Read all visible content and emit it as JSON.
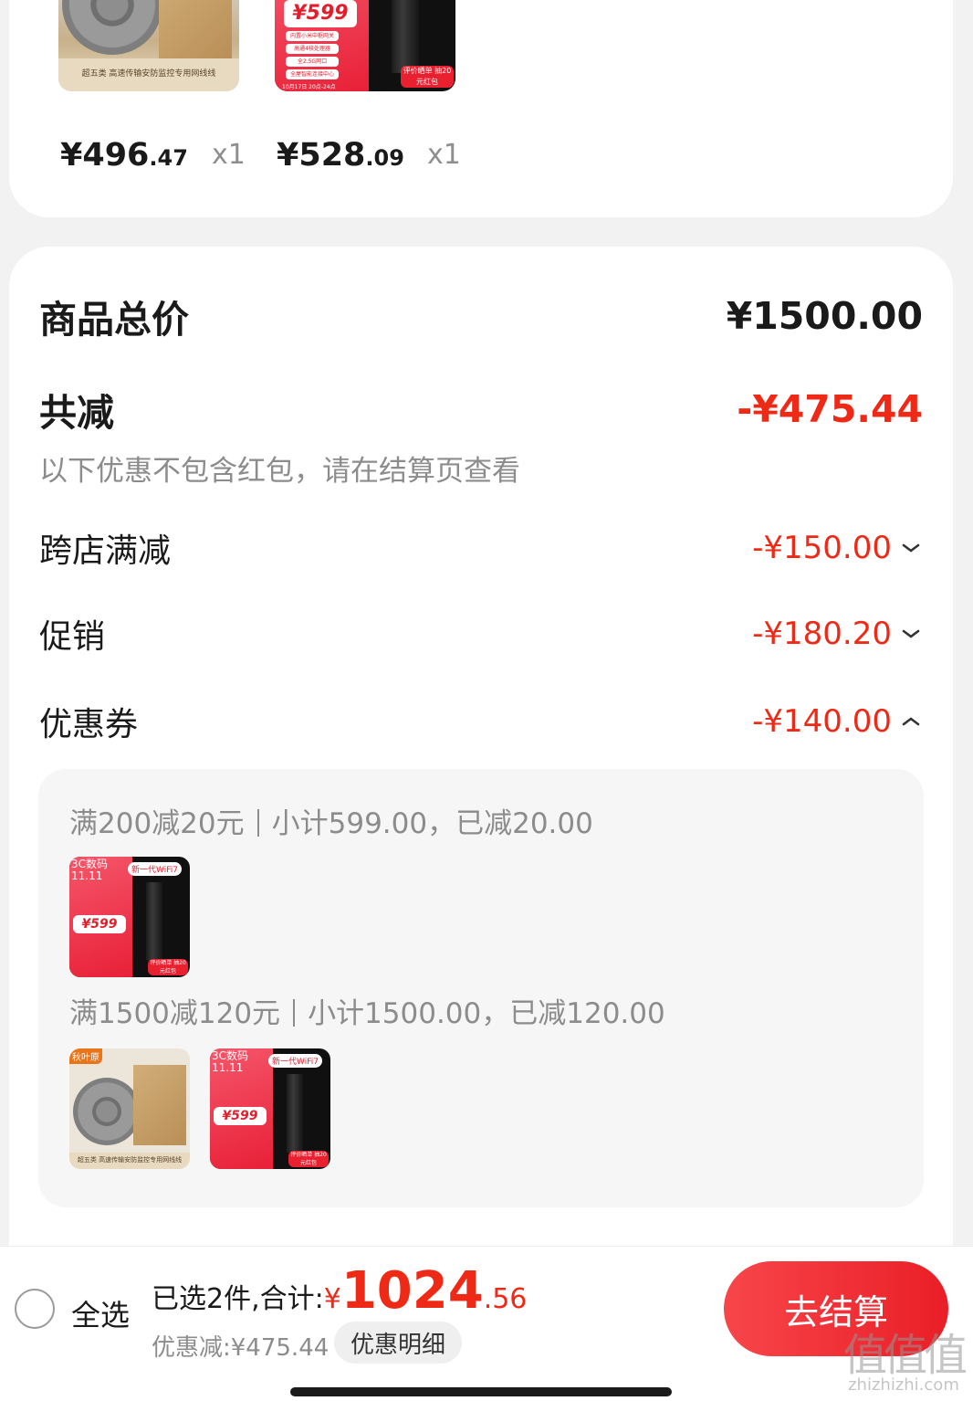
{
  "products": [
    {
      "name": "cable",
      "image_caption": "超五类 高速传输安防监控专用网线线",
      "price_int": "¥496",
      "price_dec": ".47",
      "qty": "x1"
    },
    {
      "name": "router",
      "image_price": "¥599",
      "image_tags": [
        "内置小米中枢网关",
        "高通4核处理器",
        "全2.5G网口",
        "全屋智能连接中心"
      ],
      "image_badge": "评价晒单 抽20元红包",
      "image_date": "10月17日 20点-24点",
      "price_int": "¥528",
      "price_dec": ".09",
      "qty": "x1"
    }
  ],
  "summary": {
    "total_label": "商品总价",
    "total_value": "¥1500.00",
    "reduce_label": "共减",
    "reduce_value": "-¥475.44",
    "note": "以下优惠不包含红包，请在结算页查看",
    "items": [
      {
        "label": "跨店满减",
        "value": "-¥150.00",
        "chevron": "chevron-down-icon"
      },
      {
        "label": "促销",
        "value": "-¥180.20",
        "chevron": "chevron-down-icon"
      },
      {
        "label": "优惠券",
        "value": "-¥140.00",
        "chevron": "chevron-up-icon"
      }
    ]
  },
  "coupon_details": [
    {
      "rule": "满200减20元",
      "detail": "小计599.00，已减20.00"
    },
    {
      "rule": "满1500减120元",
      "detail": "小计1500.00，已减120.00"
    }
  ],
  "thumb_text": {
    "router_brand": "3C数码",
    "router_date": "11.11",
    "router_price": "¥599",
    "router_wifi": "新一代WiFi7",
    "router_badge": "评价晒单 抽20元红包",
    "cable_brand": "秋叶原",
    "cable_caption": "超五类 高速传输安防监控专用网线线"
  },
  "bottom_bar": {
    "select_all": "全选",
    "selected_prefix": "已选2件,合计:",
    "currency": "¥",
    "total_int": "1024",
    "total_dec": ".56",
    "discount_text": "优惠减:¥475.44",
    "detail_button": "优惠明细",
    "checkout_button": "去结算"
  },
  "watermark": {
    "big": "值值值",
    "small": "zhizhizhi.com"
  },
  "colors": {
    "accent_red": "#ee2a17",
    "checkout_start": "#f7464a",
    "checkout_end": "#ea1e27"
  }
}
